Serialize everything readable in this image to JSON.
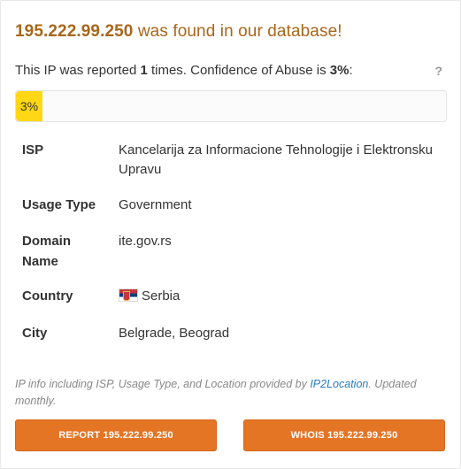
{
  "headline": {
    "ip": "195.222.99.250",
    "suffix": " was found in our database!"
  },
  "report_summary": {
    "prefix": "This IP was reported ",
    "times": "1",
    "middle": " times. Confidence of Abuse is ",
    "confidence": "3%",
    "suffix": ":",
    "help_label": "?"
  },
  "confidence_bar": {
    "label": "3%",
    "percent": 3,
    "color": "#ffd714"
  },
  "details": [
    {
      "label": "ISP",
      "value": "Kancelarija za Informacione Tehnologije i Elektronsku Upravu"
    },
    {
      "label": "Usage Type",
      "value": "Government"
    },
    {
      "label": "Domain Name",
      "value": "ite.gov.rs"
    },
    {
      "label": "Country",
      "value": "Serbia",
      "icon": "serbia-flag-icon"
    },
    {
      "label": "City",
      "value": "Belgrade, Beograd"
    }
  ],
  "footnote": {
    "prefix": "IP info including ISP, Usage Type, and Location provided by ",
    "link": "IP2Location",
    "suffix": ". Updated monthly."
  },
  "buttons": {
    "report": "REPORT 195.222.99.250",
    "whois": "WHOIS 195.222.99.250"
  },
  "colors": {
    "headline": "#a8661b",
    "button": "#e47525",
    "link": "#2a7ac0"
  }
}
